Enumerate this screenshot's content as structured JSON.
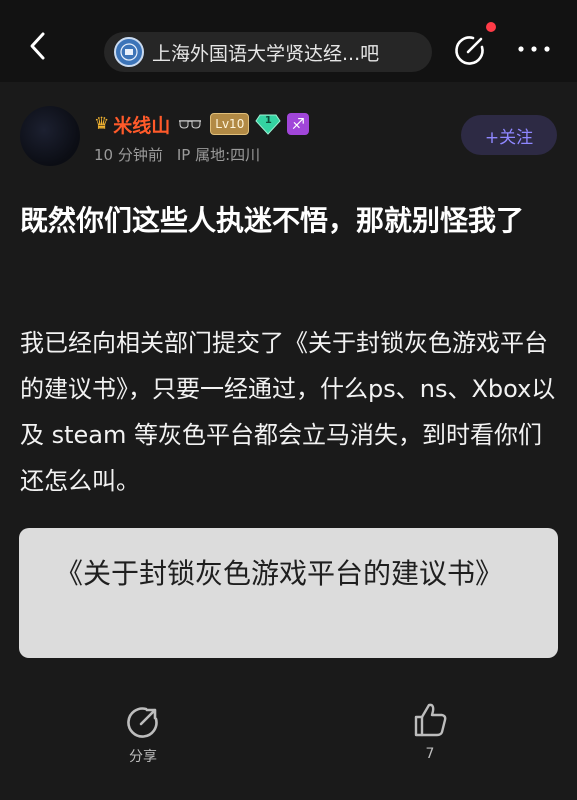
{
  "topbar": {
    "forum_name": "上海外国语大学贤达经...吧",
    "icons": [
      "back-icon",
      "forum-logo-icon",
      "edit-icon",
      "more-icon"
    ],
    "notification_dot_color": "#ff3b47"
  },
  "author": {
    "username": "米线山",
    "level": "Lv10",
    "gem_level": "1",
    "zodiac_symbol": "♐",
    "time": "10 分钟前",
    "ip_location": "IP 属地:四川",
    "username_color": "#ff5a2a"
  },
  "follow_button": {
    "label": "+关注",
    "color": "#8f87ff"
  },
  "post": {
    "title": "既然你们这些人执迷不悟，那就别怪我了",
    "body": "我已经向相关部门提交了《关于封锁灰色游戏平台的建议书》，只要一经通过，什么ps、ns、Xbox以及 steam 等灰色平台都会立马消失，到时看你们还怎么叫。",
    "quote_card_text": "《关于封锁灰色游戏平台的建议书》"
  },
  "actions": {
    "share_label": "分享",
    "like_count": "7"
  }
}
